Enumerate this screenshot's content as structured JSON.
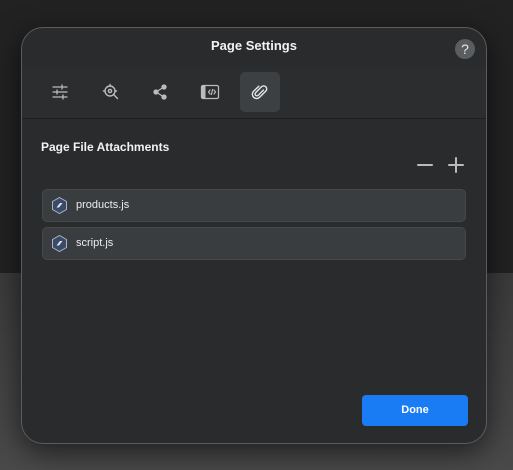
{
  "dialog": {
    "title": "Page Settings",
    "help_label": "?"
  },
  "toolbar": {
    "tabs": [
      {
        "icon": "sliders-icon",
        "active": false
      },
      {
        "icon": "search-target-icon",
        "active": false
      },
      {
        "icon": "share-icon",
        "active": false
      },
      {
        "icon": "code-embed-icon",
        "active": false
      },
      {
        "icon": "paperclip-icon",
        "active": true
      }
    ]
  },
  "attachments": {
    "heading": "Page File Attachments",
    "files": [
      {
        "name": "products.js",
        "icon": "js-file-icon"
      },
      {
        "name": "script.js",
        "icon": "js-file-icon"
      }
    ]
  },
  "footer": {
    "done_label": "Done"
  },
  "colors": {
    "accent": "#1a7cf5",
    "dialog_bg": "#292b2c",
    "row_bg": "#3a3d3f"
  }
}
